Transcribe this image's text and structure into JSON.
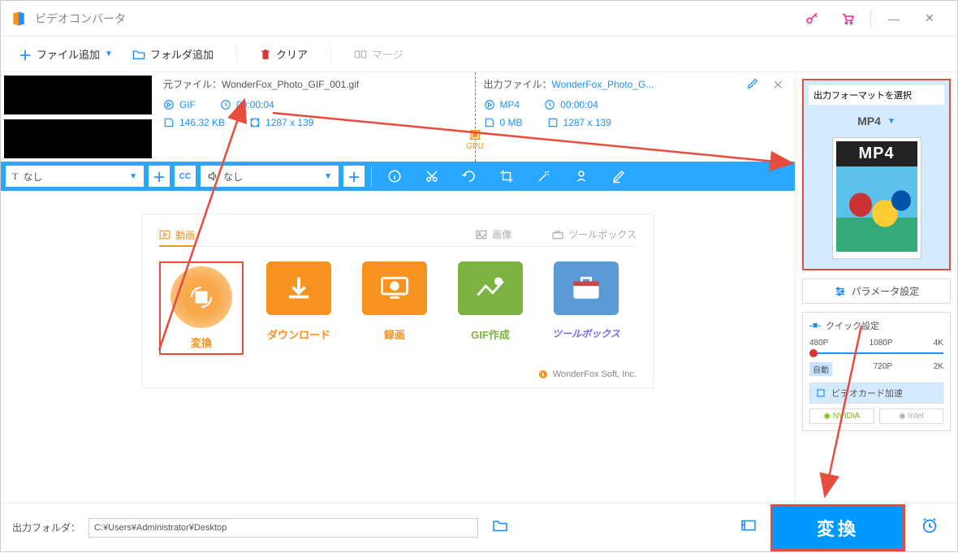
{
  "window": {
    "title": "ビデオコンバータ"
  },
  "toolbar": {
    "add_file": "ファイル追加",
    "add_folder": "フォルダ追加",
    "clear": "クリア",
    "merge": "マージ"
  },
  "file": {
    "src_label": "元ファイル：",
    "src_name": "WonderFox_Photo_GIF_001.gif",
    "src_format": "GIF",
    "src_duration": "00:00:04",
    "src_size": "146.32 KB",
    "src_dims": "1287 x 139",
    "dst_label": "出力ファイル：",
    "dst_name": "WonderFox_Photo_G...",
    "dst_format": "MP4",
    "dst_duration": "00:00:04",
    "dst_size": "0 MB",
    "dst_dims": "1287 x 139",
    "gpu": "GPU"
  },
  "editbar": {
    "subtitle": "なし",
    "audio": "なし"
  },
  "tiles_panel": {
    "tab_video": "動画",
    "tab_image": "画像",
    "tab_toolbox": "ツールボックス",
    "convert": "変換",
    "download": "ダウンロード",
    "record": "録画",
    "gif": "GIF作成",
    "toolbox": "ツールボックス",
    "footer": "WonderFox Soft, Inc."
  },
  "output": {
    "panel_title": "出力フォーマットを選択",
    "format": "MP4",
    "format_label": "MP4",
    "param_btn": "パラメータ設定",
    "quick_title": "クイック設定",
    "res_480": "480P",
    "res_1080": "1080P",
    "res_4k": "4K",
    "res_auto": "自動",
    "res_720": "720P",
    "res_2k": "2K",
    "gpu_accel": "ビデオカード加速",
    "nvidia": "NVIDIA",
    "intel": "Intel"
  },
  "footer": {
    "label": "出力フォルダ：",
    "path": "C:¥Users¥Administrator¥Desktop",
    "convert": "変換"
  }
}
